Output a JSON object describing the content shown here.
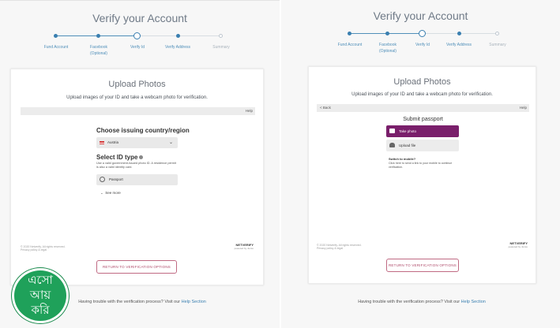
{
  "left_panel": {
    "title": "Verify your Account",
    "steps": [
      {
        "label": "Fund Account",
        "sub": "",
        "state": "done"
      },
      {
        "label": "Facebook",
        "sub": "(Optional)",
        "state": "done"
      },
      {
        "label": "Verify Id",
        "sub": "",
        "state": "current"
      },
      {
        "label": "Verify Address",
        "sub": "",
        "state": "done"
      },
      {
        "label": "Summary",
        "sub": "",
        "state": "future"
      }
    ],
    "card": {
      "title": "Upload Photos",
      "subtitle": "Upload images of your ID and take a webcam photo for verification.",
      "help": "Help",
      "country_heading": "Choose issuing country/region",
      "country_value": "Austria",
      "idtype_heading": "Select ID type",
      "idtype_desc": "Use a valid government-issued photo ID. A residence permit is also a valid identity card.",
      "passport_label": "Passport",
      "see_more": "See more",
      "footer_left": "© 2020 Netverify. All rights reserved.\nPrivacy policy & legal",
      "footer_brand": "NETVERIFY",
      "footer_brand_sub": "powered by Jumio",
      "return_button": "RETURN TO VERIFICATION OPTIONS"
    },
    "trouble_text": "Having trouble with the verification process? Visit our",
    "help_link": "Help Section"
  },
  "right_panel": {
    "title": "Verify your Account",
    "steps": [
      {
        "label": "Fund Account",
        "sub": "",
        "state": "done"
      },
      {
        "label": "Facebook",
        "sub": "(Optional)",
        "state": "done"
      },
      {
        "label": "Verify Id",
        "sub": "",
        "state": "current"
      },
      {
        "label": "Verify Address",
        "sub": "",
        "state": "done"
      },
      {
        "label": "Summary",
        "sub": "",
        "state": "future"
      }
    ],
    "card": {
      "title": "Upload Photos",
      "subtitle": "Upload images of your ID and take a webcam photo for verification.",
      "back": "< Back",
      "help": "Help",
      "submit_heading": "Submit passport",
      "take_photo": "Take photo",
      "upload_file": "Upload file",
      "switch_title": "Switch to mobile?",
      "switch_desc": "Click here to send a link to your mobile to continue verification.",
      "footer_left": "© 2020 Netverify. All rights reserved.\nPrivacy policy & legal",
      "footer_brand": "NETVERIFY",
      "footer_brand_sub": "powered by Jumio",
      "return_button": "RETURN TO VERIFICATION OPTIONS"
    },
    "trouble_text": "Having trouble with the verification process? Visit our",
    "help_link": "Help Section"
  },
  "badge": {
    "line1": "এসো",
    "line2": "আয়",
    "line3": "করি"
  },
  "colors": {
    "accent_blue": "#3a7fb0",
    "button_purple": "#7a1f6b",
    "return_border": "#c06a83",
    "badge_green": "#1fa15a"
  }
}
